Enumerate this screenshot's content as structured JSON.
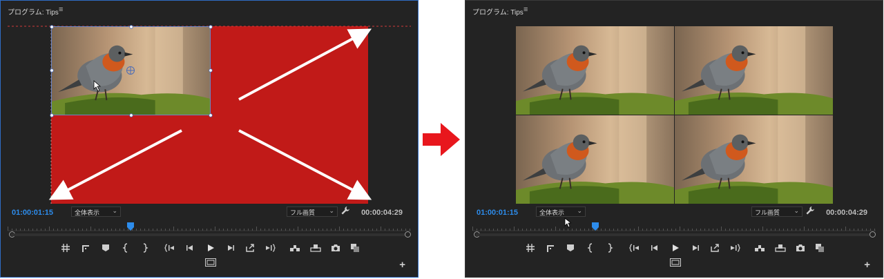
{
  "left_panel": {
    "title": "プログラム: Tips",
    "menu_icon": "hamburger-icon",
    "timecode_current": "01:00:01:15",
    "zoom_select": "全体表示",
    "resolution_select": "フル画質",
    "timecode_duration": "00:00:04:29",
    "playhead_fraction": 0.3
  },
  "right_panel": {
    "title": "プログラム: Tips",
    "menu_icon": "hamburger-icon",
    "timecode_current": "01:00:01:15",
    "zoom_select": "全体表示",
    "resolution_select": "フル画質",
    "timecode_duration": "00:00:04:29",
    "playhead_fraction": 0.3
  },
  "transport_icons": [
    "marker-add-icon",
    "mark-in-icon-ruler",
    "marker-icon",
    "mark-in-icon",
    "mark-out-icon",
    "go-to-in-icon",
    "step-back-icon",
    "play-icon",
    "step-forward-icon",
    "go-to-out-icon",
    "shuttle-icon",
    "insert-icon",
    "overwrite-icon",
    "export-frame-icon",
    "compare-icon"
  ],
  "colors": {
    "accent_timecode": "#2d8ceb",
    "highlight_red": "#c11a18",
    "panel_bg": "#232323",
    "arrow_red": "#e8171d"
  }
}
